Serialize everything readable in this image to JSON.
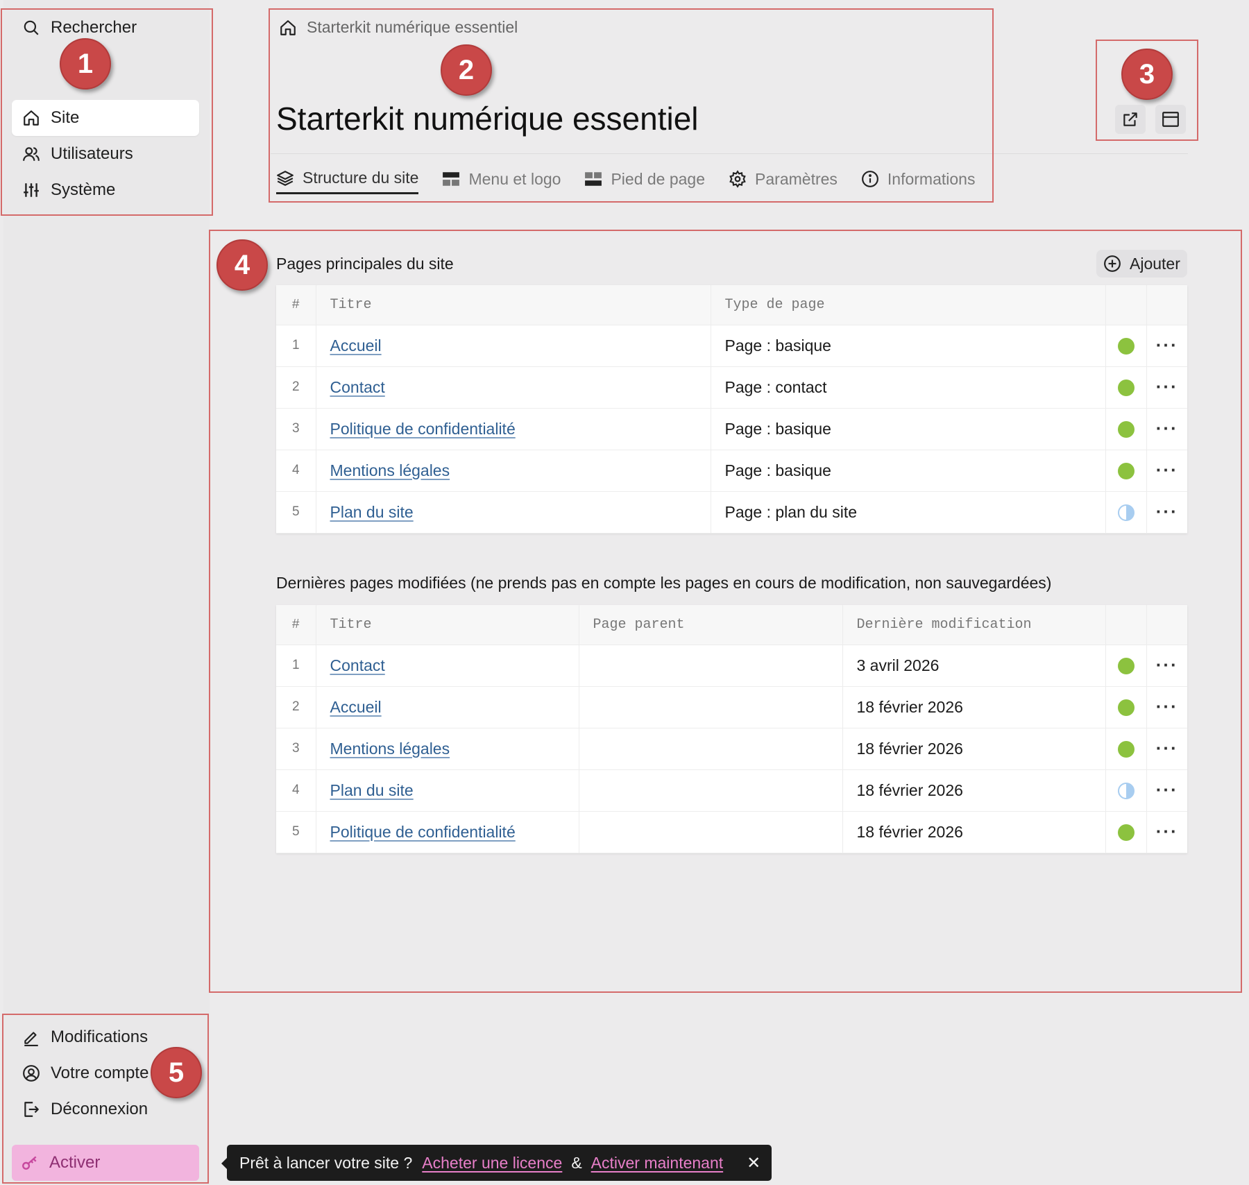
{
  "sidebar": {
    "search_label": "Rechercher",
    "items": [
      {
        "label": "Site",
        "icon": "home-icon",
        "active": true
      },
      {
        "label": "Utilisateurs",
        "icon": "users-icon"
      },
      {
        "label": "Système",
        "icon": "sliders-icon"
      }
    ],
    "bottom_items": [
      {
        "label": "Modifications",
        "icon": "pencil-icon"
      },
      {
        "label": "Votre compte",
        "icon": "user-circle-icon"
      },
      {
        "label": "Déconnexion",
        "icon": "logout-icon"
      }
    ],
    "activate_label": "Activer"
  },
  "header": {
    "breadcrumb": "Starterkit numérique essentiel",
    "title": "Starterkit numérique essentiel",
    "tabs": [
      {
        "label": "Structure du site",
        "icon": "layers-icon",
        "active": true
      },
      {
        "label": "Menu et logo",
        "icon": "menu-layout-icon"
      },
      {
        "label": "Pied de page",
        "icon": "footer-layout-icon"
      },
      {
        "label": "Paramètres",
        "icon": "gear-icon"
      },
      {
        "label": "Informations",
        "icon": "info-icon"
      }
    ]
  },
  "annotations": [
    "1",
    "2",
    "3",
    "4",
    "5"
  ],
  "main_pages": {
    "title": "Pages principales du site",
    "add_label": "Ajouter",
    "columns": [
      "#",
      "Titre",
      "Type de page"
    ],
    "rows": [
      {
        "n": "1",
        "title": "Accueil",
        "type": "Page : basique",
        "status": "published"
      },
      {
        "n": "2",
        "title": "Contact",
        "type": "Page : contact",
        "status": "published"
      },
      {
        "n": "3",
        "title": "Politique de confidentialité",
        "type": "Page : basique",
        "status": "published"
      },
      {
        "n": "4",
        "title": "Mentions légales",
        "type": "Page : basique",
        "status": "published"
      },
      {
        "n": "5",
        "title": "Plan du site",
        "type": "Page : plan du site",
        "status": "partial"
      }
    ]
  },
  "recent_pages": {
    "title": "Dernières pages modifiées (ne prends pas en compte les pages en cours de modification, non sauvegardées)",
    "columns": [
      "#",
      "Titre",
      "Page parent",
      "Dernière modification"
    ],
    "rows": [
      {
        "n": "1",
        "title": "Contact",
        "parent": "",
        "modified": "3 avril 2026",
        "status": "published"
      },
      {
        "n": "2",
        "title": "Accueil",
        "parent": "",
        "modified": "18 février 2026",
        "status": "published"
      },
      {
        "n": "3",
        "title": "Mentions légales",
        "parent": "",
        "modified": "18 février 2026",
        "status": "published"
      },
      {
        "n": "4",
        "title": "Plan du site",
        "parent": "",
        "modified": "18 février 2026",
        "status": "partial"
      },
      {
        "n": "5",
        "title": "Politique de confidentialité",
        "parent": "",
        "modified": "18 février 2026",
        "status": "published"
      }
    ]
  },
  "row_menu_label": "···",
  "toast": {
    "text": "Prêt à lancer votre site ?",
    "link1": "Acheter une licence",
    "separator": "&",
    "link2": "Activer maintenant",
    "close": "✕"
  },
  "colors": {
    "published": "#8cc23f",
    "partial": "#a8cdf0",
    "annotation": "#c94848",
    "activate_bg": "#f2b4de",
    "activate_text": "#8e2f72",
    "link": "#2f5f92",
    "toast_link": "#e87fc9"
  }
}
